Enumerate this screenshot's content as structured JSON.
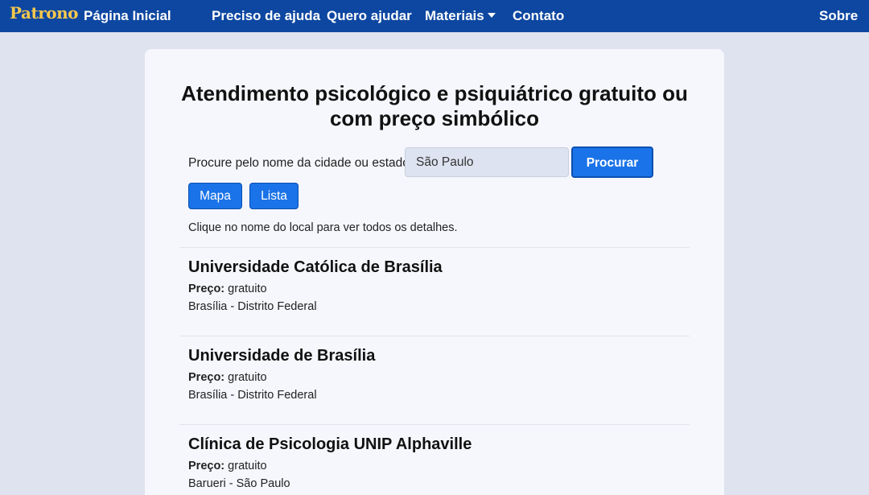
{
  "navbar": {
    "brand": "Patrono",
    "home": "Página Inicial",
    "need_help": "Preciso de ajuda",
    "want_help": "Quero ajudar",
    "materials": "Materiais",
    "contact": "Contato",
    "about": "Sobre"
  },
  "page": {
    "title_line1": "Atendimento psicológico e psiquiátrico gratuito ou",
    "title_line2": "com preço simbólico"
  },
  "search": {
    "label": "Procure pelo nome da cidade ou estado:",
    "value": "São Paulo",
    "button": "Procurar"
  },
  "view": {
    "map": "Mapa",
    "list": "Lista"
  },
  "hint": "Clique no nome do local para ver todos os detalhes.",
  "price_label": "Preço:",
  "results": [
    {
      "name": "Universidade Católica de Brasília",
      "price": "gratuito",
      "location": "Brasília - Distrito Federal"
    },
    {
      "name": "Universidade de Brasília",
      "price": "gratuito",
      "location": "Brasília - Distrito Federal"
    },
    {
      "name": "Clínica de Psicologia UNIP Alphaville",
      "price": "gratuito",
      "location": "Barueri - São Paulo"
    }
  ],
  "colors": {
    "navbar": "#0d47a1",
    "brand": "#f6c84c",
    "accent": "#1a73e8",
    "background": "#dfe3ef"
  }
}
